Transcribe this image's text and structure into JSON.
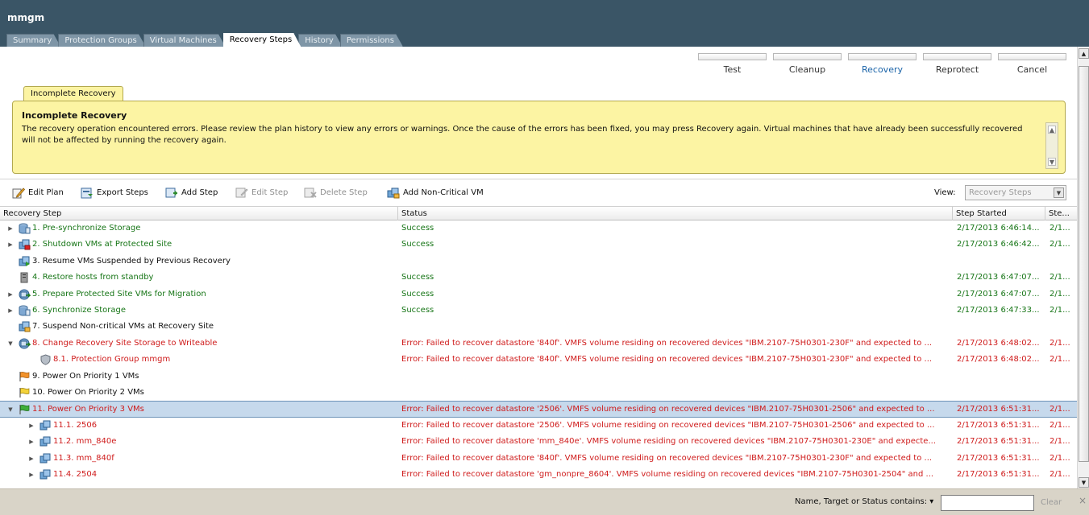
{
  "header": {
    "title": "mmgm",
    "tabs": [
      {
        "label": "Summary",
        "active": false
      },
      {
        "label": "Protection Groups",
        "active": false
      },
      {
        "label": "Virtual Machines",
        "active": false
      },
      {
        "label": "Recovery Steps",
        "active": true
      },
      {
        "label": "History",
        "active": false
      },
      {
        "label": "Permissions",
        "active": false
      }
    ]
  },
  "workflow": [
    {
      "label": "Test",
      "active": false
    },
    {
      "label": "Cleanup",
      "active": false
    },
    {
      "label": "Recovery",
      "active": true
    },
    {
      "label": "Reprotect",
      "active": false
    },
    {
      "label": "Cancel",
      "active": false
    }
  ],
  "incomplete": {
    "tab_label": "Incomplete Recovery",
    "heading": "Incomplete Recovery",
    "message": "The recovery operation encountered errors. Please review the plan history to view any errors or warnings. Once the cause of the errors has been fixed, you may press Recovery again. Virtual machines that have already been successfully recovered will not be affected by running the recovery again."
  },
  "toolbar": {
    "edit_plan": "Edit Plan",
    "export_steps": "Export Steps",
    "add_step": "Add Step",
    "edit_step": "Edit Step",
    "delete_step": "Delete Step",
    "add_noncritical": "Add Non-Critical VM",
    "view_label": "View:",
    "view_value": "Recovery Steps"
  },
  "table": {
    "columns": [
      "Recovery Step",
      "Status",
      "Step Started",
      "Ste..."
    ],
    "rows": [
      {
        "step": "1. Pre-synchronize Storage",
        "status": "Success",
        "started": "2/17/2013 6:46:14...",
        "ended": "2/1...",
        "color": "green",
        "indent": 0,
        "expander": "collapsed",
        "icon": "storage"
      },
      {
        "step": "2. Shutdown VMs at Protected Site",
        "status": "Success",
        "started": "2/17/2013 6:46:42...",
        "ended": "2/1...",
        "color": "green",
        "indent": 0,
        "expander": "collapsed",
        "icon": "vm-stop"
      },
      {
        "step": "3. Resume VMs Suspended by Previous Recovery",
        "status": "",
        "started": "",
        "ended": "",
        "color": "black",
        "indent": 0,
        "expander": "none",
        "icon": "vm-resume"
      },
      {
        "step": "4. Restore hosts from standby",
        "status": "Success",
        "started": "2/17/2013 6:47:07...",
        "ended": "2/1...",
        "color": "green",
        "indent": 0,
        "expander": "none",
        "icon": "host"
      },
      {
        "step": "5. Prepare Protected Site VMs for Migration",
        "status": "Success",
        "started": "2/17/2013 6:47:07...",
        "ended": "2/1...",
        "color": "green",
        "indent": 0,
        "expander": "collapsed",
        "icon": "migrate"
      },
      {
        "step": "6. Synchronize Storage",
        "status": "Success",
        "started": "2/17/2013 6:47:33...",
        "ended": "2/1...",
        "color": "green",
        "indent": 0,
        "expander": "collapsed",
        "icon": "storage"
      },
      {
        "step": "7. Suspend Non-critical VMs at Recovery Site",
        "status": "",
        "started": "",
        "ended": "",
        "color": "black",
        "indent": 0,
        "expander": "none",
        "icon": "vm-suspend"
      },
      {
        "step": "8. Change Recovery Site Storage to Writeable",
        "status": "Error: Failed to recover datastore '840f'. VMFS volume residing on recovered devices \"IBM.2107-75H0301-230F\" and expected to ...",
        "started": "2/17/2013 6:48:02...",
        "ended": "2/1...",
        "color": "red",
        "indent": 0,
        "expander": "expanded",
        "icon": "migrate"
      },
      {
        "step": "8.1. Protection Group mmgm",
        "status": "Error: Failed to recover datastore '840f'. VMFS volume residing on recovered devices \"IBM.2107-75H0301-230F\" and expected to ...",
        "started": "2/17/2013 6:48:02...",
        "ended": "2/1...",
        "color": "red",
        "indent": 1,
        "expander": "none",
        "icon": "shield"
      },
      {
        "step": "9. Power On Priority 1 VMs",
        "status": "",
        "started": "",
        "ended": "",
        "color": "black",
        "indent": 0,
        "expander": "none",
        "icon": "flag-orange"
      },
      {
        "step": "10. Power On Priority 2 VMs",
        "status": "",
        "started": "",
        "ended": "",
        "color": "black",
        "indent": 0,
        "expander": "none",
        "icon": "flag-yellow"
      },
      {
        "step": "11. Power On Priority 3 VMs",
        "status": "Error: Failed to recover datastore '2506'. VMFS volume residing on recovered devices \"IBM.2107-75H0301-2506\" and expected to ...",
        "started": "2/17/2013 6:51:31...",
        "ended": "2/1...",
        "color": "red",
        "indent": 0,
        "expander": "expanded",
        "icon": "flag-green",
        "selected": true
      },
      {
        "step": "11.1. 2506",
        "status": "Error: Failed to recover datastore '2506'. VMFS volume residing on recovered devices \"IBM.2107-75H0301-2506\" and expected to ...",
        "started": "2/17/2013 6:51:31...",
        "ended": "2/1...",
        "color": "red",
        "indent": 1,
        "expander": "collapsed",
        "icon": "vm"
      },
      {
        "step": "11.2. mm_840e",
        "status": "Error: Failed to recover datastore 'mm_840e'. VMFS volume residing on recovered devices \"IBM.2107-75H0301-230E\" and expecte...",
        "started": "2/17/2013 6:51:31...",
        "ended": "2/1...",
        "color": "red",
        "indent": 1,
        "expander": "collapsed",
        "icon": "vm"
      },
      {
        "step": "11.3. mm_840f",
        "status": "Error: Failed to recover datastore '840f'. VMFS volume residing on recovered devices \"IBM.2107-75H0301-230F\" and expected to ...",
        "started": "2/17/2013 6:51:31...",
        "ended": "2/1...",
        "color": "red",
        "indent": 1,
        "expander": "collapsed",
        "icon": "vm"
      },
      {
        "step": "11.4. 2504",
        "status": "Error: Failed to recover datastore 'gm_nonpre_8604'. VMFS volume residing on recovered devices \"IBM.2107-75H0301-2504\" and ...",
        "started": "2/17/2013 6:51:31...",
        "ended": "2/1...",
        "color": "red",
        "indent": 1,
        "expander": "collapsed",
        "icon": "vm"
      }
    ]
  },
  "footer": {
    "filter_label": "Name, Target or Status contains: ▾",
    "filter_value": "",
    "clear_label": "Clear",
    "close_glyph": "×"
  },
  "colors": {
    "header_bg": "#3a5566",
    "banner_bg": "#fcf4a3",
    "success": "#167516",
    "error": "#cf1b1b",
    "selected_row": "#c6d9ec",
    "footer_bg": "#d9d4c8"
  }
}
